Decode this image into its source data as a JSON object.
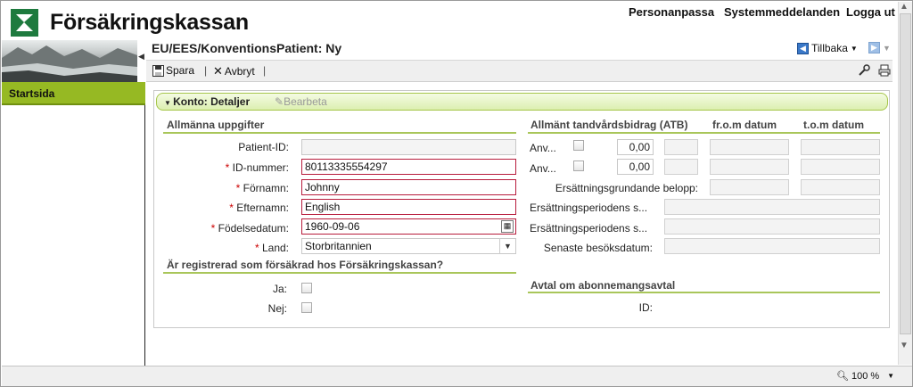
{
  "header": {
    "brand": "Försäkringskassan",
    "nav": [
      "Personanpassa",
      "Systemmeddelanden",
      "Logga ut"
    ]
  },
  "sidebar": {
    "item": "Startsida"
  },
  "page": {
    "title": "EU/EES/KonventionsPatient: Ny",
    "back": "Tillbaka"
  },
  "toolbar": {
    "save": "Spara",
    "cancel": "Avbryt"
  },
  "panel": {
    "title": "Konto: Detaljer",
    "edit": "Bearbeta"
  },
  "general": {
    "heading": "Allmänna uppgifter",
    "patient_id_label": "Patient-ID:",
    "patient_id": "",
    "id_label": "ID-nummer:",
    "id_value": "80113335554297",
    "first_label": "Förnamn:",
    "first_value": "Johnny",
    "last_label": "Efternamn:",
    "last_value": "English",
    "dob_label": "Födelsedatum:",
    "dob_value": "1960-09-06",
    "country_label": "Land:",
    "country_value": "Storbritannien",
    "required_mark": "*"
  },
  "insured": {
    "heading": "Är registrerad som försäkrad hos Försäkringskassan?",
    "yes": "Ja:",
    "no": "Nej:"
  },
  "atb": {
    "heading": "Allmänt tandvårdsbidrag (ATB)",
    "from": "fr.o.m datum",
    "to": "t.o.m datum",
    "row1_label": "Anv...",
    "row1_value": "0,00",
    "row2_label": "Anv...",
    "row2_value": "0,00",
    "basis_label": "Ersättningsgrundande belopp:",
    "period1_label": "Ersättningsperiodens s...",
    "period2_label": "Ersättningsperiodens s...",
    "last_visit_label": "Senaste besöksdatum:"
  },
  "subscription": {
    "heading": "Avtal om abonnemangsavtal",
    "id_label": "ID:"
  },
  "status": {
    "zoom": "100 %"
  }
}
